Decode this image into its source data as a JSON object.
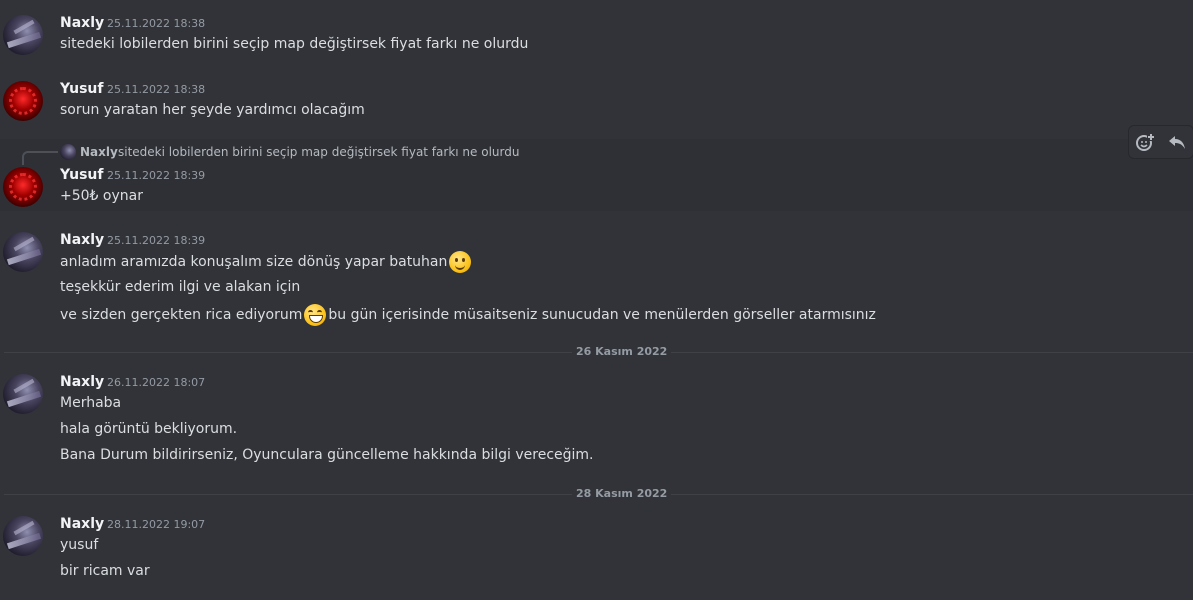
{
  "messages": [
    {
      "author": "Naxly",
      "timestamp": "25.11.2022 18:38",
      "lines": [
        "sitedeki lobilerden birini seçip map değiştirsek fiyat farkı ne olurdu"
      ]
    },
    {
      "author": "Yusuf",
      "timestamp": "25.11.2022 18:38",
      "lines": [
        "sorun yaratan her şeyde yardımcı olacağım"
      ]
    },
    {
      "author": "Yusuf",
      "timestamp": "25.11.2022 18:39",
      "reply": {
        "author": "Naxly",
        "text": "sitedeki lobilerden birini seçip map değiştirsek fiyat farkı ne olurdu"
      },
      "lines": [
        "+50₺ oynar"
      ]
    },
    {
      "author": "Naxly",
      "timestamp": "25.11.2022 18:39",
      "lines": [
        "anladım aramızda konuşalım size dönüş yapar batuhan",
        "teşekkür ederim ilgi ve alakan için",
        "ve sizden gerçekten rica ediyorum",
        "bu gün içerisinde müsaitseniz sunucudan ve menülerden görseller atarmısınız"
      ],
      "emojis": [
        "slightly-smiling-face-emoji",
        "grinning-face-emoji"
      ]
    },
    {
      "author": "Naxly",
      "timestamp": "26.11.2022 18:07",
      "lines": [
        "Merhaba",
        "hala görüntü bekliyorum.",
        "Bana Durum bildirirseniz, Oyunculara güncelleme hakkında bilgi vereceğim."
      ]
    },
    {
      "author": "Naxly",
      "timestamp": "28.11.2022 19:07",
      "lines": [
        "yusuf",
        "bir ricam var"
      ]
    }
  ],
  "dividers": [
    "26 Kasım 2022",
    "28 Kasım 2022"
  ],
  "toolbar": {
    "icons": [
      "add-reaction-icon",
      "reply-icon"
    ]
  },
  "colors": {
    "background": "#313338",
    "text": "#dbdee1",
    "muted": "#949ba4",
    "author": "#f2f3f5"
  }
}
